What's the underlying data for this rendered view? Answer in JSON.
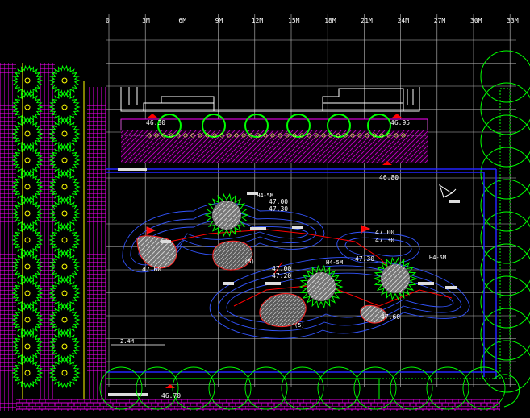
{
  "drawing": {
    "grid_labels": [
      "0",
      "3M",
      "6M",
      "9M",
      "12M",
      "15M",
      "18M",
      "21M",
      "24M",
      "27M",
      "30M",
      "33M"
    ],
    "elevations": [
      {
        "id": "e1",
        "value": "46.30"
      },
      {
        "id": "e2",
        "value": "46.95"
      },
      {
        "id": "e3",
        "value": "46.80"
      },
      {
        "id": "e4",
        "value": "47.00"
      },
      {
        "id": "e5",
        "value": "47.30"
      },
      {
        "id": "e6",
        "value": "47.00"
      },
      {
        "id": "e7",
        "value": "47.30"
      },
      {
        "id": "e8",
        "value": "47.60"
      },
      {
        "id": "e9",
        "value": "47.00"
      },
      {
        "id": "e10",
        "value": "47.20"
      },
      {
        "id": "e11",
        "value": "47.30"
      },
      {
        "id": "e12",
        "value": "47.60"
      },
      {
        "id": "e13",
        "value": "46.70"
      }
    ],
    "labels": [
      {
        "id": "l1",
        "text": "H4-5M"
      },
      {
        "id": "l2",
        "text": "H4-5M"
      },
      {
        "id": "l3",
        "text": "H4-5M"
      },
      {
        "id": "l4",
        "text": "(5)"
      },
      {
        "id": "l5",
        "text": "(5)"
      },
      {
        "id": "l6",
        "text": "2.4M"
      }
    ],
    "colors": {
      "background": "#000000",
      "grid": "#ffffff",
      "trees": "#00ff00",
      "paving": "#ff00ff",
      "water": "#0000ff",
      "contour": "#4444ff",
      "path": "#ff0000",
      "shrub": "#ffff00",
      "grey": "#808080"
    }
  }
}
